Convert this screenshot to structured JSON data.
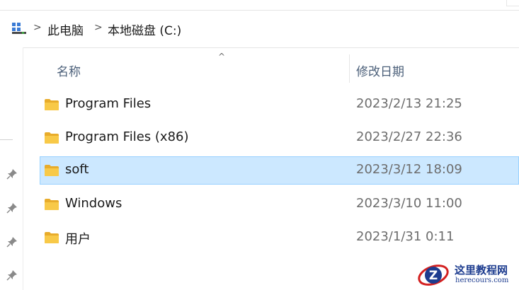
{
  "breadcrumb": {
    "items": [
      "此电脑",
      "本地磁盘 (C:)"
    ],
    "separator": ">"
  },
  "columns": {
    "name": "名称",
    "date_modified": "修改日期",
    "sort_indicator": "^"
  },
  "files": [
    {
      "name": "Program Files",
      "date": "2023/2/13 21:25",
      "type": "folder",
      "selected": false
    },
    {
      "name": "Program Files (x86)",
      "date": "2023/2/27 22:36",
      "type": "folder",
      "selected": false
    },
    {
      "name": "soft",
      "date": "2023/3/12 18:09",
      "type": "folder",
      "selected": true
    },
    {
      "name": "Windows",
      "date": "2023/3/10 11:00",
      "type": "folder",
      "selected": false
    },
    {
      "name": "用户",
      "date": "2023/1/31 0:11",
      "type": "folder",
      "selected": false
    }
  ],
  "watermark": {
    "title": "这里教程网",
    "url": "herecours.com",
    "logo_letter": "Z"
  },
  "icons": {
    "pc": "this-pc-icon",
    "folder": "folder-icon",
    "pin": "pin-icon"
  },
  "colors": {
    "selection_bg": "#cce8ff",
    "selection_border": "#99d1ff",
    "folder_yellow": "#f8c948",
    "header_text": "#4c607a",
    "date_text": "#6d6d6d"
  }
}
